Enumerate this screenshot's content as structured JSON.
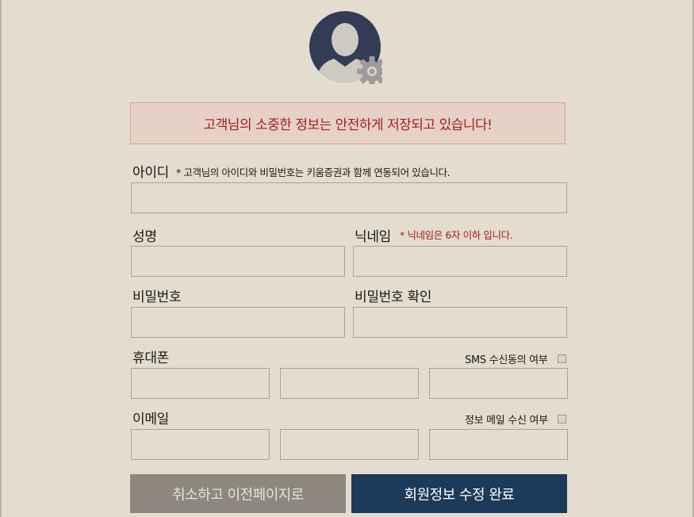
{
  "notice": "고객님의 소중한 정보는 안전하게 저장되고 있습니다!",
  "fields": {
    "id": {
      "label": "아이디",
      "hint": "* 고객님의 아이디와 비밀번호는 키움증권과 함께 연동되어 있습니다.",
      "value": ""
    },
    "name": {
      "label": "성명",
      "value": ""
    },
    "nickname": {
      "label": "닉네임",
      "hint": "* 닉네임은 6자 이하 입니다.",
      "value": ""
    },
    "password": {
      "label": "비밀번호",
      "value": ""
    },
    "password_confirm": {
      "label": "비밀번호 확인",
      "value": ""
    },
    "phone": {
      "label": "휴대폰",
      "parts": [
        "",
        "",
        ""
      ],
      "consent_label": "SMS 수신동의 여부",
      "consent_checked": false
    },
    "email": {
      "label": "이메일",
      "parts": [
        "",
        "",
        ""
      ],
      "consent_label": "정보 메일 수신 여부",
      "consent_checked": false
    }
  },
  "buttons": {
    "cancel": "취소하고 이전페이지로",
    "submit": "회원정보 수정 완료"
  },
  "colors": {
    "background": "#e3dccf",
    "notice_text": "#a31d1d",
    "notice_bg": "#e6d1c7",
    "cancel_button": "#8d8780",
    "submit_button": "#1c3a59"
  },
  "icons": {
    "avatar": "user-settings-icon"
  }
}
